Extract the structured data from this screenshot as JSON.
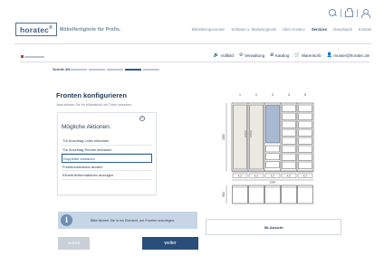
{
  "header": {
    "logo_text": "horatec",
    "logo_sup": "®",
    "tagline": "Möbelfertigteile für Profis.",
    "nav": [
      {
        "label": "Möbelkomponenten",
        "active": false
      },
      {
        "label": "Software u. Marketingtools",
        "active": false
      },
      {
        "label": "Über Horatec",
        "active": false
      },
      {
        "label": "Services",
        "active": true
      },
      {
        "label": "Downloads",
        "active": false
      },
      {
        "label": "Kontakt",
        "active": false
      }
    ],
    "icons": [
      "search-icon",
      "bag-icon",
      "user-icon"
    ]
  },
  "toolbar": {
    "items": [
      {
        "icon": "🔊",
        "label": "Vollbild"
      },
      {
        "icon": "⚙",
        "label": "Verwaltung"
      },
      {
        "icon": "✿",
        "label": "Katalog"
      },
      {
        "icon": "🛒",
        "label": "Warenkorb"
      },
      {
        "icon": "👤",
        "label": "muster@horatec.de"
      }
    ]
  },
  "stepper": {
    "label": "Schritt 4/5",
    "total": 5,
    "current": 4
  },
  "config": {
    "title": "Fronten konfigurieren",
    "subtitle": "Jetzt können Sie Ihr Möbelstück mit Türen versehen.",
    "actions_title": "Mögliche Aktionen:",
    "close_symbol": "×",
    "actions": [
      {
        "label": "Tür Anschlag Links einbauen",
        "selected": false
      },
      {
        "label": "Tür Anschlag Rechts einbauen",
        "selected": false
      },
      {
        "label": "Doppeltür einbauen",
        "selected": true
      },
      {
        "label": "Frontkonstruktion ändern",
        "selected": false
      },
      {
        "label": "Elementinformationen anzeigen",
        "selected": false
      }
    ]
  },
  "drawing": {
    "column_numbers": [
      "1",
      "2",
      "3",
      "4",
      "5"
    ],
    "height_main": "2200",
    "height_lower": "800",
    "widths": [
      "417",
      "417",
      "417",
      "417",
      "417"
    ],
    "total_width": "2084",
    "highlight_color": "#a7b9d3",
    "line_color": "#555555"
  },
  "info": {
    "icon": "i",
    "text": "Bitte klicken Sie in ein Element, um Fronten anzulegen."
  },
  "view3d_label": "3D-Ansicht",
  "buttons": {
    "back": "zurück",
    "next": "weiter"
  }
}
